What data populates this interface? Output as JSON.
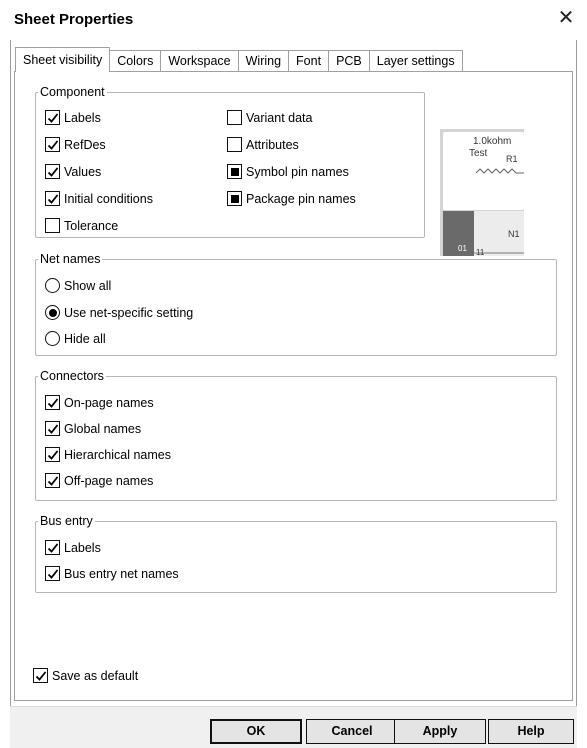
{
  "window": {
    "title": "Sheet Properties",
    "close_glyph": "✕"
  },
  "tabs": [
    {
      "label": "Sheet visibility",
      "active": true
    },
    {
      "label": "Colors"
    },
    {
      "label": "Workspace"
    },
    {
      "label": "Wiring"
    },
    {
      "label": "Font"
    },
    {
      "label": "PCB"
    },
    {
      "label": "Layer settings"
    }
  ],
  "component": {
    "legend": "Component",
    "items": [
      {
        "label": "Labels",
        "state": "checked"
      },
      {
        "label": "RefDes",
        "state": "checked"
      },
      {
        "label": "Values",
        "state": "checked"
      },
      {
        "label": "Initial conditions",
        "state": "checked"
      },
      {
        "label": "Tolerance",
        "state": "unchecked"
      },
      {
        "label": "Variant data",
        "state": "unchecked"
      },
      {
        "label": "Attributes",
        "state": "unchecked"
      },
      {
        "label": "Symbol pin names",
        "state": "indeterminate"
      },
      {
        "label": "Package pin names",
        "state": "indeterminate"
      }
    ]
  },
  "preview": {
    "value_text": "1.0kohm",
    "label_text": "Test",
    "refdes_text": "R1",
    "net_text": "N1",
    "pin_text_1": "01",
    "pin_text_2": "11"
  },
  "net_names": {
    "legend": "Net names",
    "options": [
      {
        "label": "Show all",
        "selected": false
      },
      {
        "label": "Use net-specific setting",
        "selected": true
      },
      {
        "label": "Hide all",
        "selected": false
      }
    ]
  },
  "connectors": {
    "legend": "Connectors",
    "items": [
      {
        "label": "On-page names",
        "state": "checked"
      },
      {
        "label": "Global names",
        "state": "checked"
      },
      {
        "label": "Hierarchical names",
        "state": "checked"
      },
      {
        "label": "Off-page names",
        "state": "checked"
      }
    ]
  },
  "bus_entry": {
    "legend": "Bus entry",
    "items": [
      {
        "label": "Labels",
        "state": "checked"
      },
      {
        "label": "Bus entry net names",
        "state": "checked"
      }
    ]
  },
  "save_default": {
    "label": "Save as default",
    "state": "checked"
  },
  "buttons": {
    "ok": "OK",
    "cancel": "Cancel",
    "apply": "Apply",
    "help": "Help"
  }
}
